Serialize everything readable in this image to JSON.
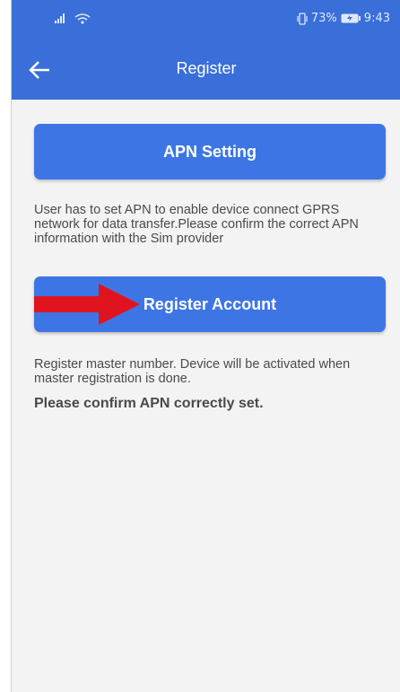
{
  "status_bar": {
    "battery": "73%",
    "time": "9:43",
    "icons": [
      "signal-icon",
      "wifi-icon",
      "vibrate-icon",
      "battery-icon"
    ]
  },
  "header": {
    "title": "Register",
    "back_icon": "arrow-left-icon"
  },
  "apn": {
    "button_label": "APN Setting",
    "description": "User has to set APN to enable device connect GPRS network for data transfer.Please confirm the correct APN information with the Sim provider"
  },
  "register": {
    "button_label": "Register Account",
    "description": "Register master number. Device will be activated when master registration is done.",
    "confirm_note": "Please confirm APN correctly set."
  },
  "colors": {
    "primary": "#3a6fd9",
    "button": "#3d76e4",
    "background": "#f3f3f3",
    "annotation_arrow": "#e0141e"
  }
}
